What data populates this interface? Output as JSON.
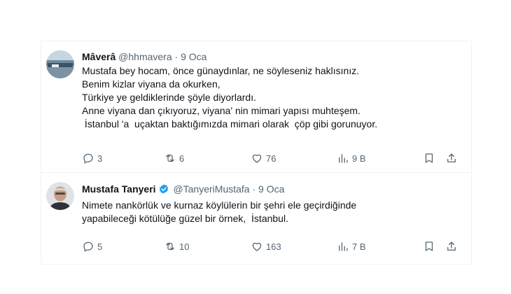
{
  "tweets": [
    {
      "display_name": "Mâverâ",
      "handle": "@hhmavera",
      "separator": "·",
      "date": "9 Oca",
      "text": "Mustafa bey hocam, önce günaydınlar, ne söyleseniz haklısınız.\nBenim kizlar viyana da okurken,\nTürkiye ye geldiklerinde şöyle diyorlardı.\nAnne viyana dan çıkıyoruz, viyana' nin mimari yapısı muhteşem.\n İstanbul 'a  uçaktan baktığımızda mimari olarak  çöp gibi gorunuyor.",
      "verified": false,
      "replies": "3",
      "reposts": "6",
      "likes": "76",
      "views": "9 B"
    },
    {
      "display_name": "Mustafa Tanyeri",
      "handle": "@TanyeriMustafa",
      "separator": "·",
      "date": "9 Oca",
      "text": "Nimete nankörlük ve kurnaz köylülerin bir şehri ele geçirdiğinde\nyapabileceği kötülüğe güzel bir örnek,  İstanbul.",
      "verified": true,
      "replies": "5",
      "reposts": "10",
      "likes": "163",
      "views": "7 B"
    }
  ],
  "colors": {
    "muted": "#536471",
    "text": "#0f1419",
    "verified": "#1d9bf0",
    "border": "#eff3f4"
  },
  "icons": [
    "reply-icon",
    "repost-icon",
    "like-icon",
    "views-icon",
    "bookmark-icon",
    "share-icon",
    "verified-badge-icon"
  ]
}
